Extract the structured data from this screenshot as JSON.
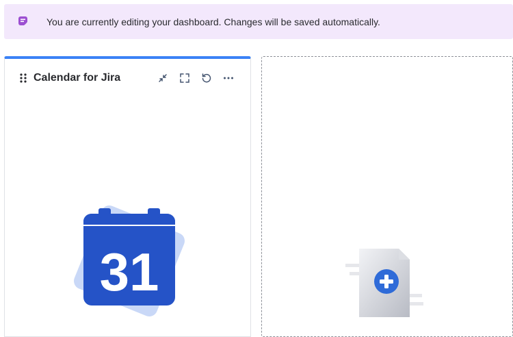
{
  "banner": {
    "icon": "edit-note-icon",
    "message": "You are currently editing your dashboard. Changes will be saved automatically.",
    "icon_color": "#9c4fd1",
    "background": "#f3e8fc"
  },
  "gadget": {
    "title": "Calendar for Jira",
    "accent_color": "#3b82f6",
    "actions": [
      {
        "name": "minimize",
        "icon": "minimize-icon"
      },
      {
        "name": "maximize",
        "icon": "maximize-icon"
      },
      {
        "name": "refresh",
        "icon": "refresh-icon"
      },
      {
        "name": "more",
        "icon": "more-icon"
      }
    ],
    "calendar_day": "31",
    "calendar_color": "#2553c7"
  },
  "empty_slot": {
    "icon": "add-gadget-icon",
    "accent_color": "#2f6bd8"
  }
}
